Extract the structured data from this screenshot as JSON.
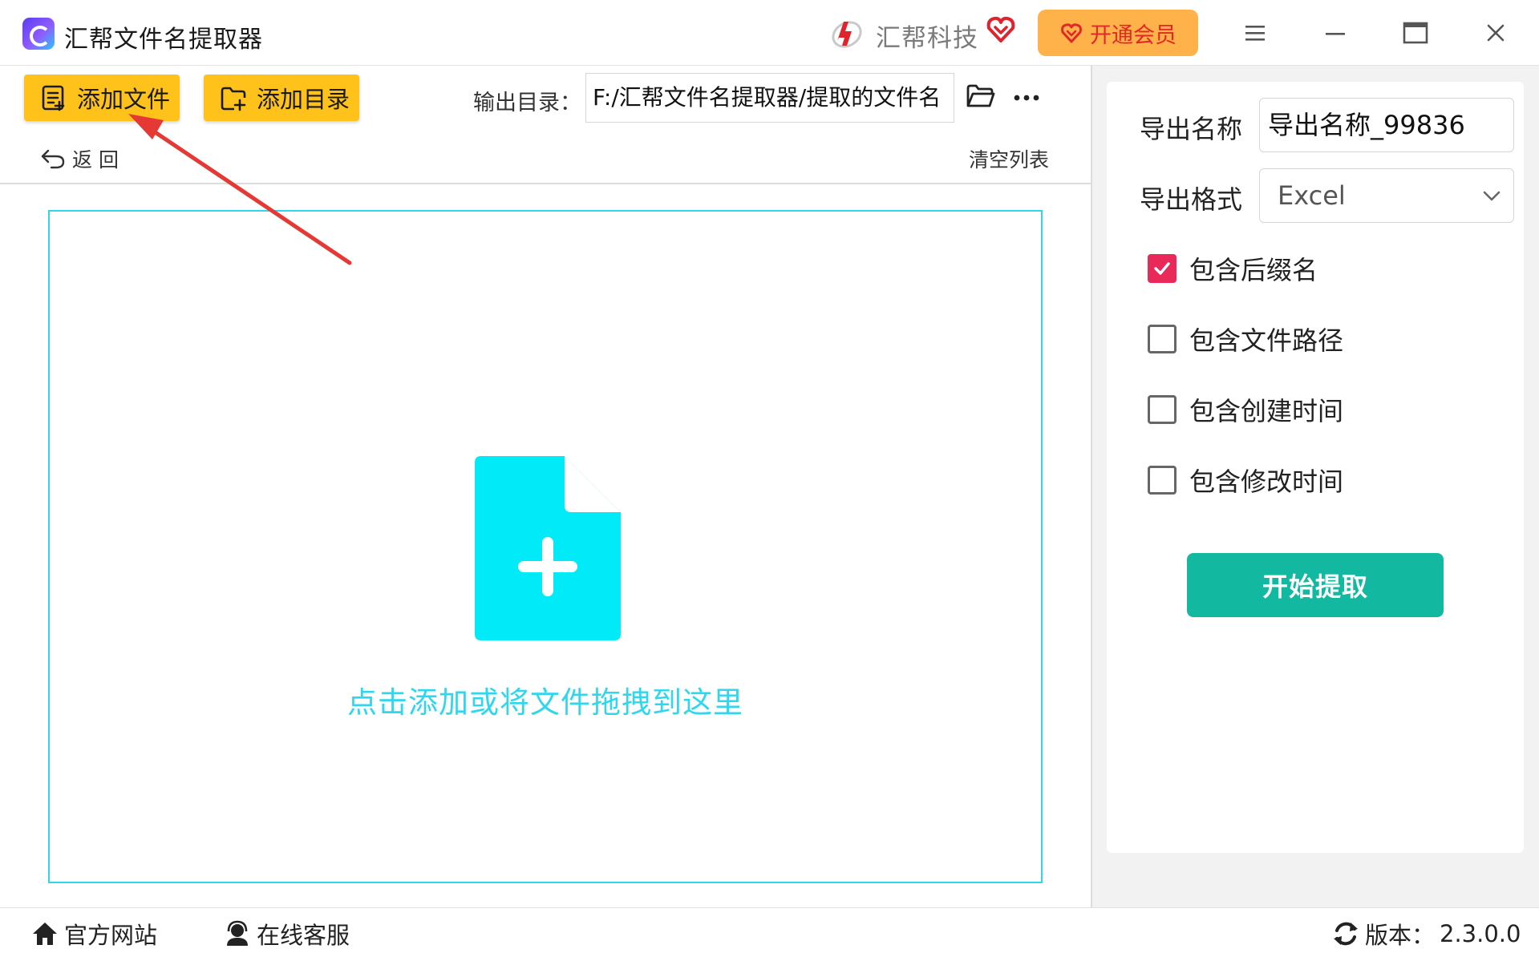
{
  "app": {
    "title": "汇帮文件名提取器"
  },
  "brand": {
    "name": "汇帮科技"
  },
  "header": {
    "vip_label": "开通会员"
  },
  "toolbar": {
    "add_file_label": "添加文件",
    "add_folder_label": "添加目录",
    "output_dir_label": "输出目录：",
    "output_dir_value": "F:/汇帮文件名提取器/提取的文件名",
    "back_label": "返 回",
    "clear_label": "清空列表"
  },
  "dropzone": {
    "text": "点击添加或将文件拖拽到这里"
  },
  "settings": {
    "export_name_label": "导出名称",
    "export_name_value": "导出名称_99836",
    "export_format_label": "导出格式",
    "export_format_value": "Excel",
    "options": [
      {
        "label": "包含后缀名",
        "checked": true
      },
      {
        "label": "包含文件路径",
        "checked": false
      },
      {
        "label": "包含创建时间",
        "checked": false
      },
      {
        "label": "包含修改时间",
        "checked": false
      }
    ],
    "start_label": "开始提取"
  },
  "footer": {
    "website_label": "官方网站",
    "support_label": "在线客服",
    "version_label": "版本：",
    "version_value": "2.3.0.0"
  },
  "colors": {
    "accent_yellow": "#ffc21a",
    "vip_orange": "#ffb14a",
    "dropzone_cyan": "#2ed6f0",
    "start_teal": "#13b8a1",
    "checkbox_pink": "#e8295a",
    "arrow_red": "#e53935"
  },
  "icons": [
    "app-logo-icon",
    "brand-mark-icon",
    "heart-icon",
    "menu-icon",
    "minimize-icon",
    "maximize-icon",
    "close-icon",
    "add-file-icon",
    "add-folder-icon",
    "folder-open-icon",
    "more-icon",
    "back-arrow-icon",
    "file-plus-icon",
    "chevron-down-icon",
    "check-icon",
    "home-icon",
    "support-icon",
    "refresh-icon"
  ]
}
